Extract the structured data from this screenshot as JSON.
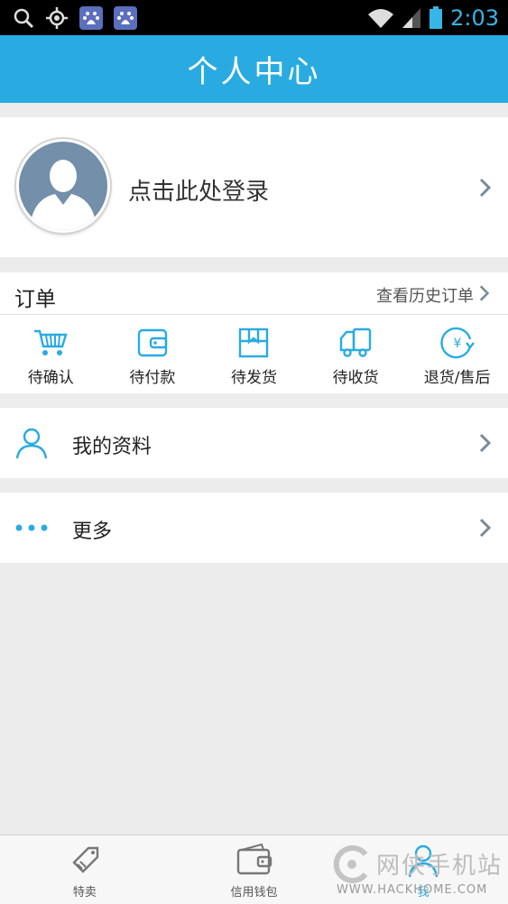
{
  "status_bar": {
    "time": "2:03",
    "icons": [
      "search-icon",
      "gps-icon",
      "baidu-icon",
      "baidu-icon",
      "wifi-icon",
      "signal-icon",
      "battery-icon"
    ],
    "accent": "#35b6e6"
  },
  "header": {
    "title": "个人中心",
    "color": "#29abe2"
  },
  "login": {
    "prompt": "点击此处登录",
    "icon": "avatar-placeholder"
  },
  "orders": {
    "title": "订单",
    "history_link": "查看历史订单",
    "items": [
      {
        "label": "待确认",
        "icon": "cart-icon"
      },
      {
        "label": "待付款",
        "icon": "wallet-icon"
      },
      {
        "label": "待发货",
        "icon": "package-icon"
      },
      {
        "label": "待收货",
        "icon": "truck-icon"
      },
      {
        "label": "退货/售后",
        "icon": "refund-icon"
      }
    ]
  },
  "menu": {
    "profile": {
      "label": "我的资料",
      "icon": "user-icon"
    },
    "more": {
      "label": "更多",
      "icon": "more-dots-icon"
    }
  },
  "tabbar": {
    "tabs": [
      {
        "label": "特卖",
        "icon": "tag-icon"
      },
      {
        "label": "信用钱包",
        "icon": "wallet-icon"
      },
      {
        "label": "我",
        "icon": "user-icon",
        "active": true
      }
    ]
  },
  "watermark": {
    "text": "网侠手机站",
    "url": "WWW.HACKHOME.COM"
  }
}
